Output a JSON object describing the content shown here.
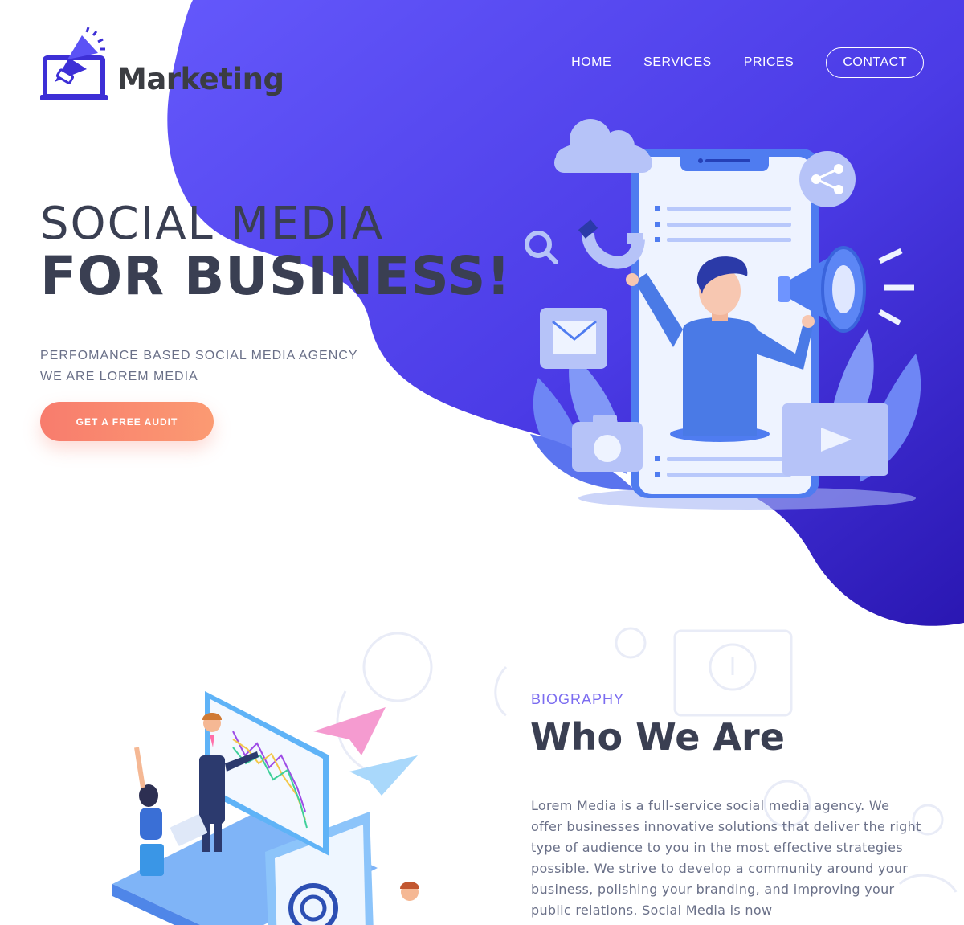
{
  "brand": {
    "name": "Marketing",
    "accent": "#5b52f5",
    "accent_dark": "#2d1eb8",
    "cta_color": "#f87c6d"
  },
  "nav": {
    "items": [
      {
        "label": "HOME"
      },
      {
        "label": "SERVICES"
      },
      {
        "label": "PRICES"
      },
      {
        "label": "CONTACT"
      }
    ]
  },
  "hero": {
    "line1": "SOCIAL MEDIA",
    "line2": "FOR BUSINESS!",
    "sub1": "PERFOMANCE BASED SOCIAL MEDIA AGENCY",
    "sub2": "WE ARE LOREM MEDIA",
    "cta": "GET A FREE AUDIT"
  },
  "biography": {
    "kicker": "BIOGRAPHY",
    "title": "Who We Are",
    "body": "Lorem Media is a full-service social media agency. We offer businesses innovative solutions that deliver the right type of audience to you in the most effective strategies possible. We strive to develop a community around your business, polishing your branding, and improving your public relations. Social Media is now"
  },
  "icons": {
    "logo": "megaphone-laptop-icon",
    "share": "share-icon",
    "search": "search-icon",
    "magnet": "magnet-icon",
    "mail": "mail-icon",
    "camera": "camera-icon",
    "video": "play-icon",
    "megaphone": "megaphone-icon",
    "cloud": "cloud-icon"
  }
}
